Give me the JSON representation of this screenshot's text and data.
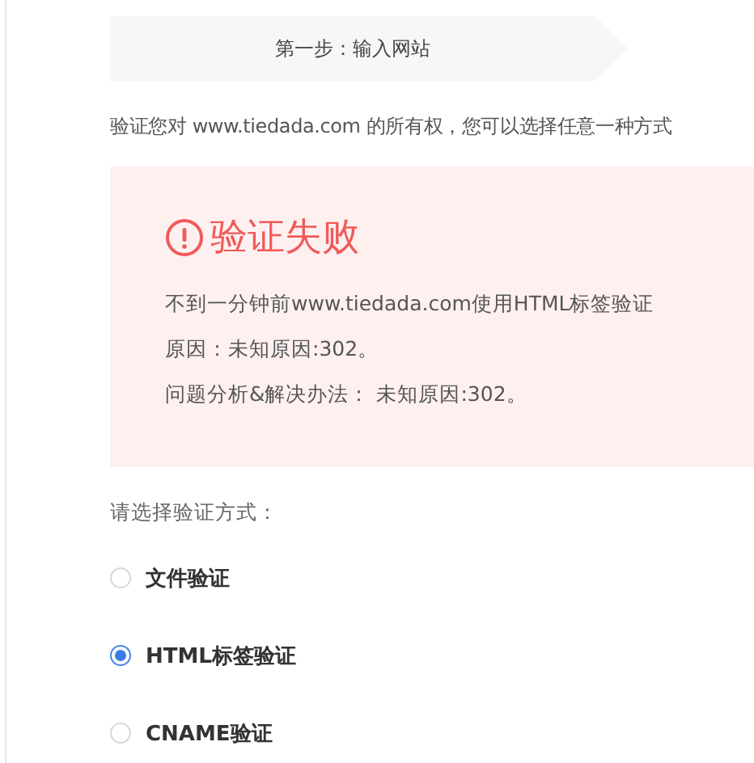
{
  "steps": [
    {
      "label": "第一步：输入网站"
    }
  ],
  "intro": "验证您对 www.tiedada.com 的所有权，您可以选择任意一种方式",
  "alert": {
    "title": "验证失败",
    "lines": [
      "不到一分钟前www.tiedada.com使用HTML标签验证",
      "原因：未知原因:302。",
      "问题分析&解决办法： 未知原因:302。"
    ]
  },
  "method_label": "请选择验证方式：",
  "methods": [
    {
      "label": "文件验证",
      "selected": false
    },
    {
      "label": "HTML标签验证",
      "selected": true
    },
    {
      "label": "CNAME验证",
      "selected": false
    }
  ]
}
